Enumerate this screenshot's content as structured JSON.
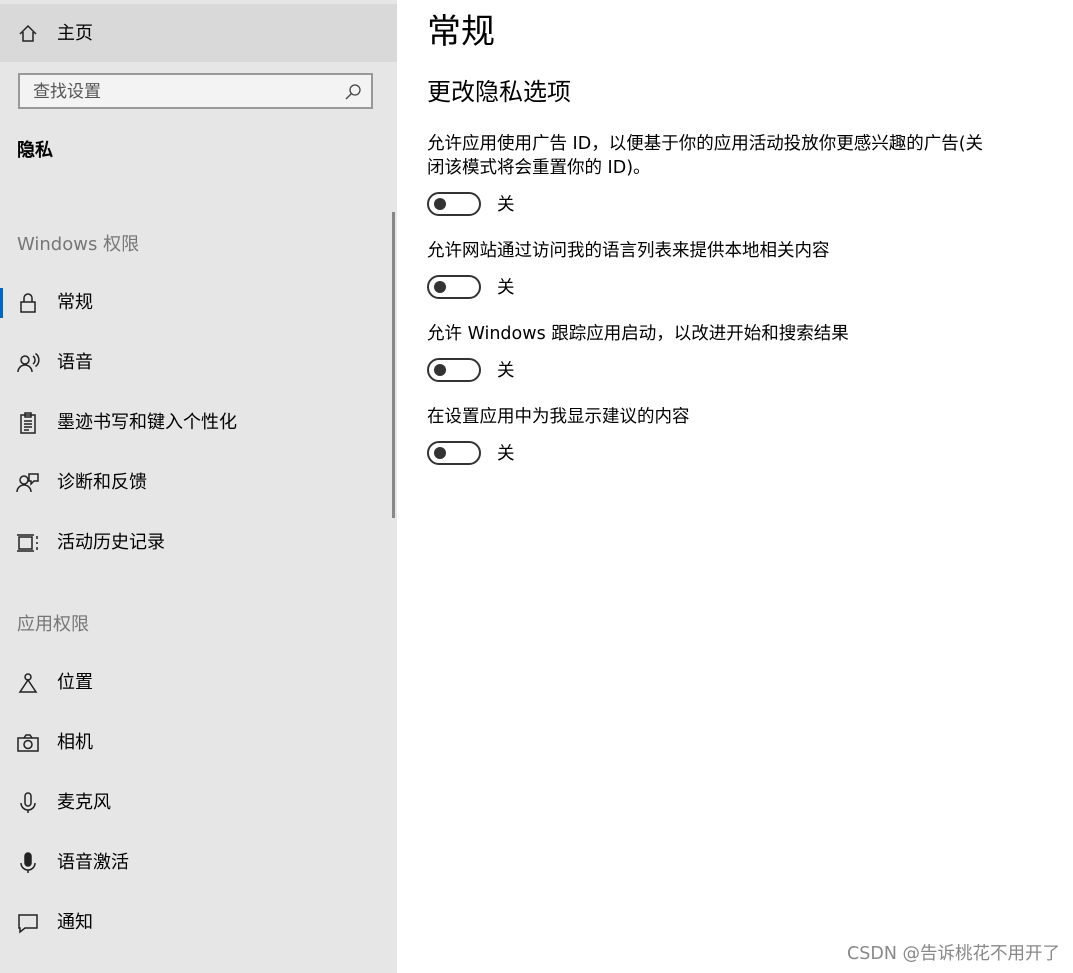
{
  "sidebar": {
    "home_label": "主页",
    "search_placeholder": "查找设置",
    "section_title": "隐私",
    "windows_group": {
      "title": "Windows 权限",
      "items": [
        {
          "label": "常规",
          "icon": "lock-icon",
          "active": true
        },
        {
          "label": "语音",
          "icon": "speech-icon"
        },
        {
          "label": "墨迹书写和键入个性化",
          "icon": "clipboard-icon"
        },
        {
          "label": "诊断和反馈",
          "icon": "feedback-icon"
        },
        {
          "label": "活动历史记录",
          "icon": "timeline-icon"
        }
      ]
    },
    "app_group": {
      "title": "应用权限",
      "items": [
        {
          "label": "位置",
          "icon": "location-icon"
        },
        {
          "label": "相机",
          "icon": "camera-icon"
        },
        {
          "label": "麦克风",
          "icon": "microphone-icon"
        },
        {
          "label": "语音激活",
          "icon": "voice-activation-icon"
        },
        {
          "label": "通知",
          "icon": "notification-icon"
        }
      ]
    }
  },
  "main": {
    "title": "常规",
    "subtitle": "更改隐私选项",
    "settings": [
      {
        "description": "允许应用使用广告 ID，以便基于你的应用活动投放你更感兴趣的广告(关闭该模式将会重置你的 ID)。",
        "state": "关",
        "on": false
      },
      {
        "description": "允许网站通过访问我的语言列表来提供本地相关内容",
        "state": "关",
        "on": false
      },
      {
        "description": "允许 Windows 跟踪应用启动，以改进开始和搜索结果",
        "state": "关",
        "on": false
      },
      {
        "description": "在设置应用中为我显示建议的内容",
        "state": "关",
        "on": false
      }
    ]
  },
  "watermark": "CSDN @告诉桃花不用开了",
  "colors": {
    "accent": "#0067c0",
    "sidebar_bg": "#e6e6e6",
    "home_bg": "#d9d9d9"
  }
}
